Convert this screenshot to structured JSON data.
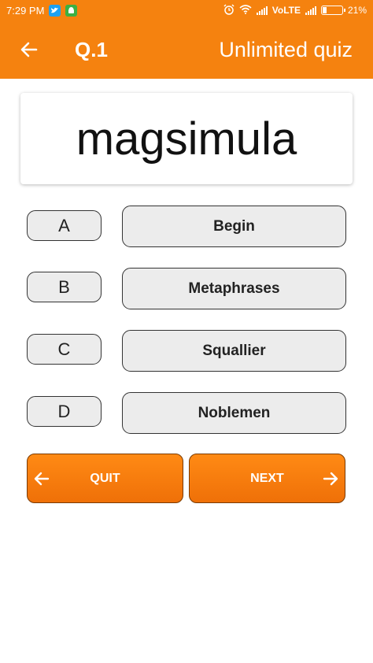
{
  "status_bar": {
    "time": "7:29 PM",
    "network": "VoLTE",
    "battery": "21%",
    "battery_level": 0.21,
    "icons": [
      "twitter-icon",
      "android-icon",
      "alarm-icon",
      "wifi-icon",
      "signal-icon",
      "battery-icon"
    ]
  },
  "app_bar": {
    "question_number": "Q.1",
    "title": "Unlimited quiz",
    "back_icon": "arrow-left-icon"
  },
  "question": {
    "word": "magsimula"
  },
  "options": [
    {
      "letter": "A",
      "text": "Begin"
    },
    {
      "letter": "B",
      "text": "Metaphrases"
    },
    {
      "letter": "C",
      "text": "Squallier"
    },
    {
      "letter": "D",
      "text": "Noblemen"
    }
  ],
  "navigation": {
    "quit_label": "QUIT",
    "next_label": "NEXT"
  },
  "colors": {
    "accent": "#f5820f",
    "button_bg": "#ececec",
    "text_dark": "#111111"
  }
}
